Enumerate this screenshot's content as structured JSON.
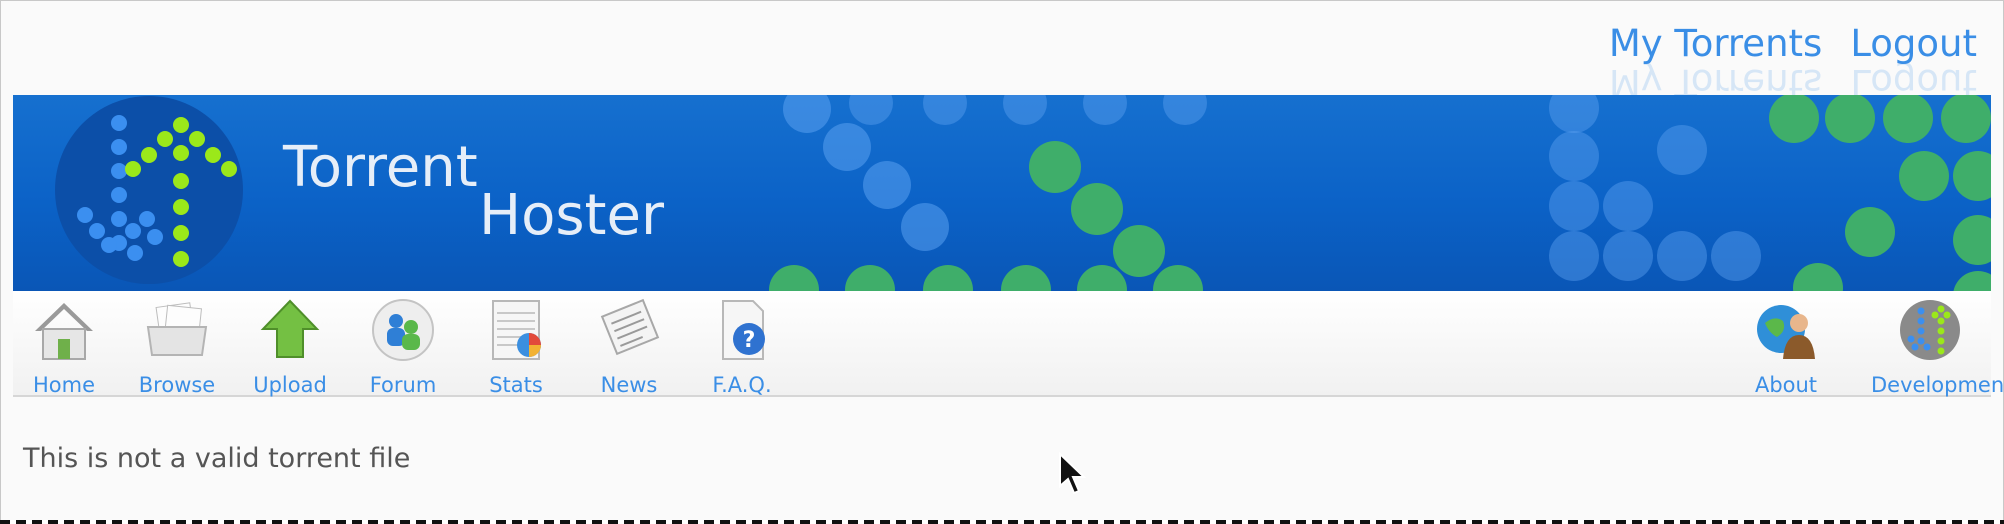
{
  "header": {
    "links": [
      {
        "label": "My Torrents"
      },
      {
        "label": "Logout"
      }
    ]
  },
  "banner": {
    "title_line1": "Torrent",
    "title_line2": "Hoster"
  },
  "nav": {
    "left_items": [
      {
        "label": "Home",
        "icon": "house-icon"
      },
      {
        "label": "Browse",
        "icon": "files-icon"
      },
      {
        "label": "Upload",
        "icon": "upload-arrow-icon"
      },
      {
        "label": "Forum",
        "icon": "people-bubble-icon"
      },
      {
        "label": "Stats",
        "icon": "spreadsheet-chart-icon"
      },
      {
        "label": "News",
        "icon": "newspaper-icon"
      },
      {
        "label": "F.A.Q.",
        "icon": "help-document-icon"
      }
    ],
    "right_items": [
      {
        "label": "About",
        "icon": "globe-person-icon"
      },
      {
        "label": "Development",
        "icon": "logo-arrow-icon"
      }
    ]
  },
  "main": {
    "message": "This is not a valid torrent file"
  },
  "colors": {
    "link": "#3a8ee6",
    "banner_blue": "#0b62c7",
    "logo_green": "#9be81a",
    "logo_dot_blue": "#3b8ff0"
  }
}
